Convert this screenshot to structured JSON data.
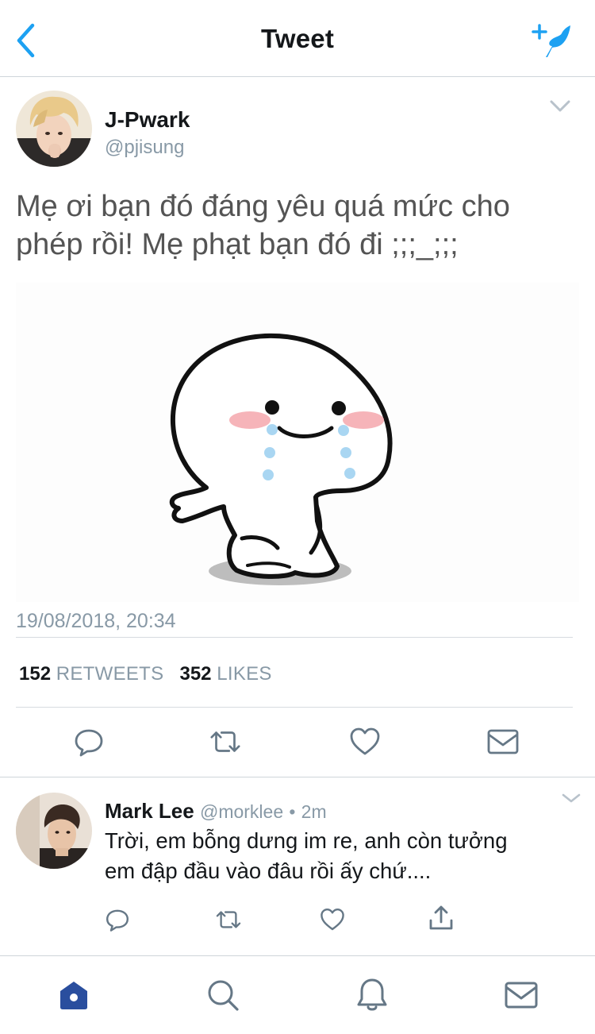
{
  "header": {
    "title": "Tweet"
  },
  "tweet": {
    "author_name": "J-Pwark",
    "author_handle": "@pjisung",
    "text_line1": "Mẹ ơi bạn đó đáng yêu quá mức cho",
    "text_line2": "phép rồi! Mẹ phạt bạn đó đi ;;;_;;;",
    "timestamp": "19/08/2018, 20:34",
    "retweets_count": "152",
    "retweets_label": "RETWEETS",
    "likes_count": "352",
    "likes_label": "LIKES"
  },
  "reply": {
    "author_name": "Mark Lee",
    "author_handle": "@morklee",
    "separator": "•",
    "time": "2m",
    "text_line1": "Trời, em bỗng dưng im re, anh còn tưởng",
    "text_line2": "em đập đầu vào đâu rồi ấy chứ...."
  },
  "colors": {
    "accent": "#1da1f2",
    "tab_active": "#2a4e9e",
    "icon_gray": "#657786"
  },
  "icons": [
    "back-icon",
    "compose-icon",
    "chevron-down-icon",
    "reply-icon",
    "retweet-icon",
    "like-icon",
    "message-icon",
    "share-icon",
    "home-icon",
    "search-icon",
    "notifications-icon"
  ]
}
